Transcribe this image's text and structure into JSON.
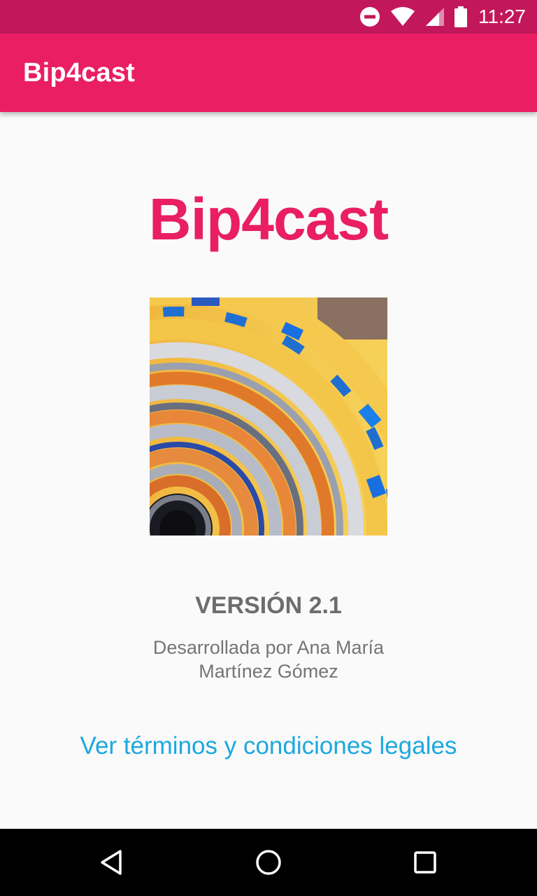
{
  "status_bar": {
    "time": "11:27",
    "icons": [
      "do-not-disturb-icon",
      "wifi-icon",
      "signal-icon",
      "battery-icon"
    ],
    "color": "#c2185b"
  },
  "app_bar": {
    "title": "Bip4cast",
    "color": "#e91e63"
  },
  "main": {
    "hero_title": "Bip4cast",
    "logo_icon": "fractal-logo-image",
    "version": "VERSIÓN 2.1",
    "developer_line1": "Desarrollada por Ana María",
    "developer_line2": "Martínez Gómez",
    "terms_link": "Ver términos y condiciones legales",
    "link_color": "#1ca8e0"
  },
  "nav_bar": {
    "icons": [
      "back-icon",
      "home-icon",
      "recents-icon"
    ]
  }
}
